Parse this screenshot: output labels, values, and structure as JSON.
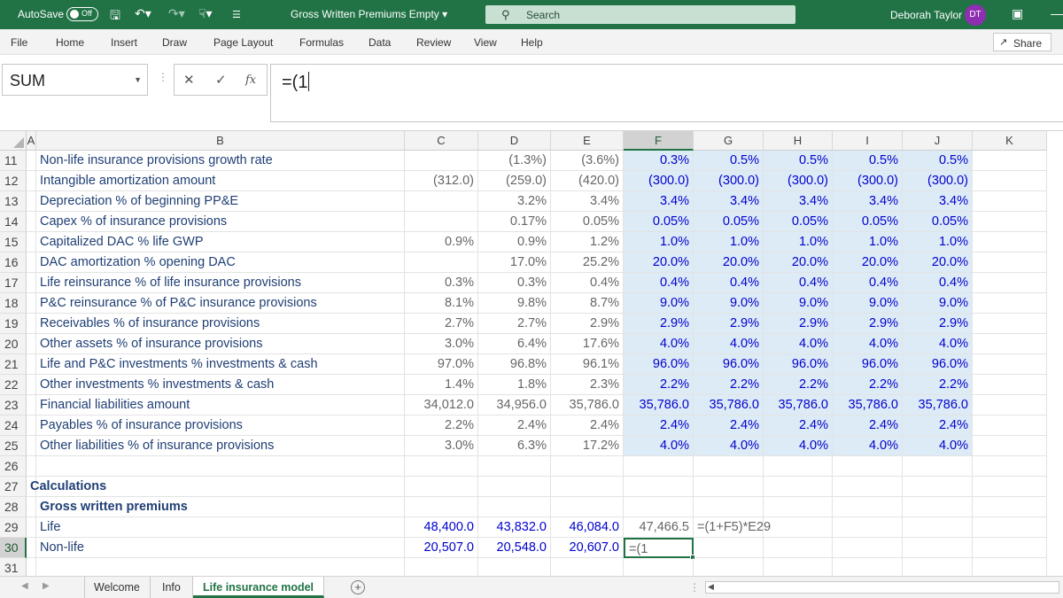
{
  "titlebar": {
    "autosave_label": "AutoSave",
    "autosave_state": "Off",
    "doc_title": "Gross Written Premiums Empty",
    "search_placeholder": "Search",
    "user_name": "Deborah Taylor",
    "user_initials": "DT",
    "colors": {
      "bar": "#217346",
      "avatar": "#8e2eb1"
    }
  },
  "ribbon": {
    "tabs": [
      "File",
      "Home",
      "Insert",
      "Draw",
      "Page Layout",
      "Formulas",
      "Data",
      "Review",
      "View",
      "Help"
    ],
    "share_label": "Share"
  },
  "formula_bar": {
    "name_box": "SUM",
    "fx_label": "fx",
    "formula": "=(1"
  },
  "columns": [
    "A",
    "B",
    "C",
    "D",
    "E",
    "F",
    "G",
    "H",
    "I",
    "J",
    "K"
  ],
  "selected_column": "F",
  "rows": [
    {
      "n": "11",
      "label": "Non-life insurance provisions growth rate",
      "vals": [
        "",
        "(1.3%)",
        "(3.6%)",
        "0.3%",
        "0.5%",
        "0.5%",
        "0.5%",
        "0.5%"
      ]
    },
    {
      "n": "12",
      "label": "Intangible amortization amount",
      "vals": [
        "(312.0)",
        "(259.0)",
        "(420.0)",
        "(300.0)",
        "(300.0)",
        "(300.0)",
        "(300.0)",
        "(300.0)"
      ]
    },
    {
      "n": "13",
      "label": "Depreciation % of beginning PP&E",
      "vals": [
        "",
        "3.2%",
        "3.4%",
        "3.4%",
        "3.4%",
        "3.4%",
        "3.4%",
        "3.4%"
      ]
    },
    {
      "n": "14",
      "label": "Capex % of insurance provisions",
      "vals": [
        "",
        "0.17%",
        "0.05%",
        "0.05%",
        "0.05%",
        "0.05%",
        "0.05%",
        "0.05%"
      ]
    },
    {
      "n": "15",
      "label": "Capitalized DAC % life GWP",
      "vals": [
        "0.9%",
        "0.9%",
        "1.2%",
        "1.0%",
        "1.0%",
        "1.0%",
        "1.0%",
        "1.0%"
      ]
    },
    {
      "n": "16",
      "label": "DAC amortization % opening DAC",
      "vals": [
        "",
        "17.0%",
        "25.2%",
        "20.0%",
        "20.0%",
        "20.0%",
        "20.0%",
        "20.0%"
      ]
    },
    {
      "n": "17",
      "label": "Life reinsurance % of life insurance provisions",
      "vals": [
        "0.3%",
        "0.3%",
        "0.4%",
        "0.4%",
        "0.4%",
        "0.4%",
        "0.4%",
        "0.4%"
      ]
    },
    {
      "n": "18",
      "label": "P&C reinsurance % of P&C insurance provisions",
      "vals": [
        "8.1%",
        "9.8%",
        "8.7%",
        "9.0%",
        "9.0%",
        "9.0%",
        "9.0%",
        "9.0%"
      ]
    },
    {
      "n": "19",
      "label": "Receivables % of insurance provisions",
      "vals": [
        "2.7%",
        "2.7%",
        "2.9%",
        "2.9%",
        "2.9%",
        "2.9%",
        "2.9%",
        "2.9%"
      ]
    },
    {
      "n": "20",
      "label": "Other assets % of insurance provisions",
      "vals": [
        "3.0%",
        "6.4%",
        "17.6%",
        "4.0%",
        "4.0%",
        "4.0%",
        "4.0%",
        "4.0%"
      ]
    },
    {
      "n": "21",
      "label": "Life and P&C investments % investments & cash",
      "vals": [
        "97.0%",
        "96.8%",
        "96.1%",
        "96.0%",
        "96.0%",
        "96.0%",
        "96.0%",
        "96.0%"
      ]
    },
    {
      "n": "22",
      "label": "Other investments % investments & cash",
      "vals": [
        "1.4%",
        "1.8%",
        "2.3%",
        "2.2%",
        "2.2%",
        "2.2%",
        "2.2%",
        "2.2%"
      ]
    },
    {
      "n": "23",
      "label": "Financial liabilities amount",
      "vals": [
        "34,012.0",
        "34,956.0",
        "35,786.0",
        "35,786.0",
        "35,786.0",
        "35,786.0",
        "35,786.0",
        "35,786.0"
      ]
    },
    {
      "n": "24",
      "label": "Payables % of insurance provisions",
      "vals": [
        "2.2%",
        "2.4%",
        "2.4%",
        "2.4%",
        "2.4%",
        "2.4%",
        "2.4%",
        "2.4%"
      ]
    },
    {
      "n": "25",
      "label": "Other liabilities % of insurance provisions",
      "vals": [
        "3.0%",
        "6.3%",
        "17.2%",
        "4.0%",
        "4.0%",
        "4.0%",
        "4.0%",
        "4.0%"
      ]
    }
  ],
  "calc": {
    "row26": "26",
    "row27": "27",
    "calculations_label": "Calculations",
    "row28": "28",
    "gwp_label": "Gross written premiums",
    "row29": "29",
    "life_label": "Life",
    "life_vals": [
      "48,400.0",
      "43,832.0",
      "46,084.0",
      "47,466.5"
    ],
    "life_g_formula": "=(1+F5)*E29",
    "row30": "30",
    "nonlife_label": "Non-life",
    "nonlife_vals": [
      "20,507.0",
      "20,548.0",
      "20,607.0"
    ],
    "nonlife_f_edit": "=(1",
    "row31": "31"
  },
  "sheets": [
    "Welcome",
    "Info",
    "Life insurance model"
  ],
  "active_sheet": "Life insurance model"
}
